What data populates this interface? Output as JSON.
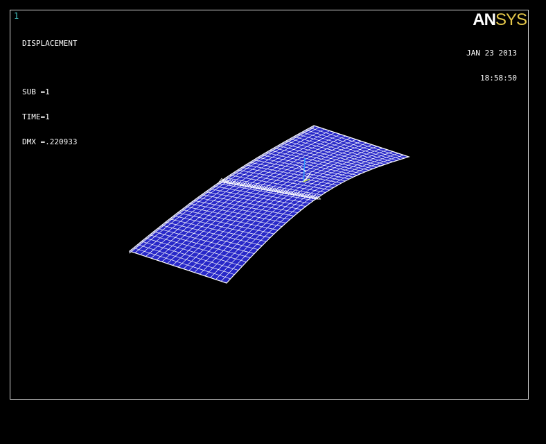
{
  "window": {
    "number": "1"
  },
  "plot_info": {
    "title": "DISPLACEMENT",
    "sub": "SUB =1",
    "time": "TIME=1",
    "dmx": "DMX =.220933"
  },
  "date": {
    "date": "JAN 23 2013",
    "time": "18:58:50"
  },
  "logo": {
    "part1": "AN",
    "part2": "SYS"
  },
  "colors": {
    "background": "#000000",
    "mesh_fill": "#2828c8",
    "mesh_line": "#ffffff",
    "border": "#d9d9d9",
    "window_number": "#46c0c0",
    "logo_an": "#ffffff",
    "logo_sys": "#e6c84a",
    "triad_x": "#ffffff",
    "triad_y": "#3399ff",
    "triad_z": "#bfd84a"
  },
  "icons": {
    "triad": "coordinate-triad-icon",
    "logo": "ansys-logo-icon"
  }
}
